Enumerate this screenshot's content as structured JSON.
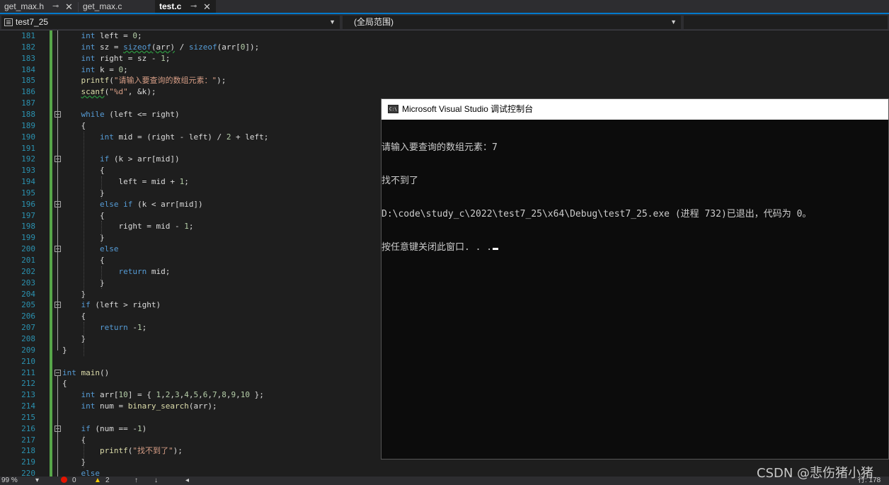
{
  "tabs": [
    {
      "label": "get_max.h",
      "pinned": true,
      "active": false
    },
    {
      "label": "get_max.c",
      "pinned": false,
      "active": false
    },
    {
      "label": "test.c",
      "pinned": true,
      "active": true
    }
  ],
  "navbar": {
    "project": "test7_25",
    "scope": "(全局范围)"
  },
  "editor": {
    "lines": [
      {
        "n": "181",
        "html": "    <span class=\"kw\">int</span> left = <span class=\"num\">0</span>;"
      },
      {
        "n": "182",
        "html": "    <span class=\"kw\">int</span> sz = <span class=\"kw sq\">sizeof</span><span class=\"sq\">(arr)</span> / <span class=\"kw\">sizeof</span>(arr[<span class=\"num\">0</span>]);"
      },
      {
        "n": "183",
        "html": "    <span class=\"kw\">int</span> right = sz - <span class=\"num\">1</span>;"
      },
      {
        "n": "184",
        "html": "    <span class=\"kw\">int</span> k = <span class=\"num\">0</span>;"
      },
      {
        "n": "185",
        "html": "    <span class=\"fn\">printf</span>(<span class=\"str\">\"请输入要查询的数组元素：\"</span>);"
      },
      {
        "n": "186",
        "html": "    <span class=\"fn sq\">scanf</span>(<span class=\"str\">\"%d\"</span>, &amp;k);"
      },
      {
        "n": "187",
        "html": ""
      },
      {
        "n": "188",
        "html": "    <span class=\"kw\">while</span> (left &lt;= right)"
      },
      {
        "n": "189",
        "html": "    {"
      },
      {
        "n": "190",
        "html": "        <span class=\"kw\">int</span> mid = (right - left) / <span class=\"num\">2</span> + left;"
      },
      {
        "n": "191",
        "html": ""
      },
      {
        "n": "192",
        "html": "        <span class=\"kw\">if</span> (k &gt; arr[mid])"
      },
      {
        "n": "193",
        "html": "        {"
      },
      {
        "n": "194",
        "html": "            left = mid + <span class=\"num\">1</span>;"
      },
      {
        "n": "195",
        "html": "        }"
      },
      {
        "n": "196",
        "html": "        <span class=\"kw\">else if</span> (k &lt; arr[mid])"
      },
      {
        "n": "197",
        "html": "        {"
      },
      {
        "n": "198",
        "html": "            right = mid - <span class=\"num\">1</span>;"
      },
      {
        "n": "199",
        "html": "        }"
      },
      {
        "n": "200",
        "html": "        <span class=\"kw\">else</span>"
      },
      {
        "n": "201",
        "html": "        {"
      },
      {
        "n": "202",
        "html": "            <span class=\"kw\">return</span> mid;"
      },
      {
        "n": "203",
        "html": "        }"
      },
      {
        "n": "204",
        "html": "    }"
      },
      {
        "n": "205",
        "html": "    <span class=\"kw\">if</span> (left &gt; right)"
      },
      {
        "n": "206",
        "html": "    {"
      },
      {
        "n": "207",
        "html": "        <span class=\"kw\">return</span> -<span class=\"num\">1</span>;"
      },
      {
        "n": "208",
        "html": "    }"
      },
      {
        "n": "209",
        "html": "}"
      },
      {
        "n": "210",
        "html": ""
      },
      {
        "n": "211",
        "html": "<span class=\"kw\">int</span> <span class=\"fn\">main</span>()"
      },
      {
        "n": "212",
        "html": "{"
      },
      {
        "n": "213",
        "html": "    <span class=\"kw\">int</span> arr[<span class=\"num\">10</span>] = { <span class=\"num\">1</span>,<span class=\"num\">2</span>,<span class=\"num\">3</span>,<span class=\"num\">4</span>,<span class=\"num\">5</span>,<span class=\"num\">6</span>,<span class=\"num\">7</span>,<span class=\"num\">8</span>,<span class=\"num\">9</span>,<span class=\"num\">10</span> };"
      },
      {
        "n": "214",
        "html": "    <span class=\"kw\">int</span> num = <span class=\"fn\">binary_search</span>(arr);"
      },
      {
        "n": "215",
        "html": ""
      },
      {
        "n": "216",
        "html": "    <span class=\"kw\">if</span> (num == -<span class=\"num\">1</span>)"
      },
      {
        "n": "217",
        "html": "    {"
      },
      {
        "n": "218",
        "html": "        <span class=\"fn\">printf</span>(<span class=\"str\">\"找不到了\"</span>);"
      },
      {
        "n": "219",
        "html": "    }"
      },
      {
        "n": "220",
        "html": "    <span class=\"kw\">else</span>"
      }
    ]
  },
  "console": {
    "title": "Microsoft Visual Studio 调试控制台",
    "lines": [
      "请输入要查询的数组元素：7",
      "找不到了",
      "D:\\code\\study_c\\2022\\test7_25\\x64\\Debug\\test7_25.exe (进程 732)已退出，代码为 0。",
      "按任意键关闭此窗口. . ."
    ]
  },
  "statusbar": {
    "zoom": "99 %",
    "errors": "0",
    "warnings": "2",
    "line": "行: 178"
  },
  "watermark": "CSDN @悲伤猪小猪",
  "colors": {
    "keyword": "#569cd6",
    "string": "#d69d85",
    "function": "#dcdcaa",
    "line_number": "#2b91af",
    "change_bar": "#57a64a",
    "accent": "#007acc"
  }
}
